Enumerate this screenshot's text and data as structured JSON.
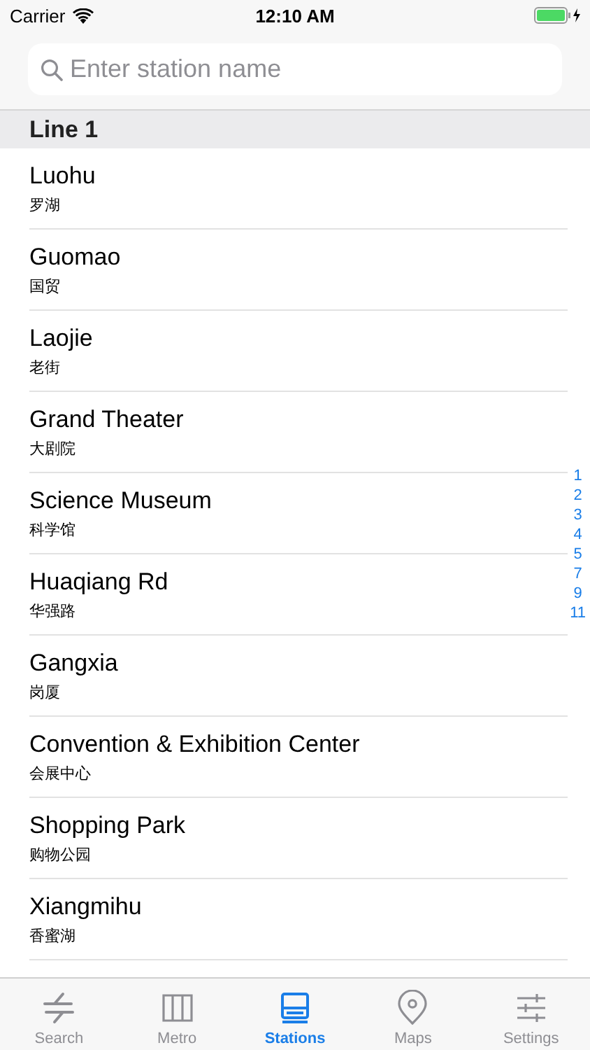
{
  "status_bar": {
    "carrier": "Carrier",
    "time": "12:10 AM"
  },
  "search": {
    "placeholder": "Enter station name"
  },
  "section": {
    "title": "Line 1"
  },
  "stations": [
    {
      "name": "Luohu",
      "name_zh": "罗湖"
    },
    {
      "name": "Guomao",
      "name_zh": "国贸"
    },
    {
      "name": "Laojie",
      "name_zh": "老街"
    },
    {
      "name": "Grand Theater",
      "name_zh": "大剧院"
    },
    {
      "name": "Science Museum",
      "name_zh": "科学馆"
    },
    {
      "name": "Huaqiang Rd",
      "name_zh": "华强路"
    },
    {
      "name": "Gangxia",
      "name_zh": "岗厦"
    },
    {
      "name": "Convention & Exhibition Center",
      "name_zh": "会展中心"
    },
    {
      "name": "Shopping Park",
      "name_zh": "购物公园"
    },
    {
      "name": "Xiangmihu",
      "name_zh": "香蜜湖"
    }
  ],
  "index": [
    "1",
    "2",
    "3",
    "4",
    "5",
    "7",
    "9",
    "11"
  ],
  "tabs": [
    {
      "kind": "search",
      "label": "Search",
      "selected": false
    },
    {
      "kind": "metro",
      "label": "Metro",
      "selected": false
    },
    {
      "kind": "stations",
      "label": "Stations",
      "selected": true
    },
    {
      "kind": "maps",
      "label": "Maps",
      "selected": false
    },
    {
      "kind": "settings",
      "label": "Settings",
      "selected": false
    }
  ]
}
